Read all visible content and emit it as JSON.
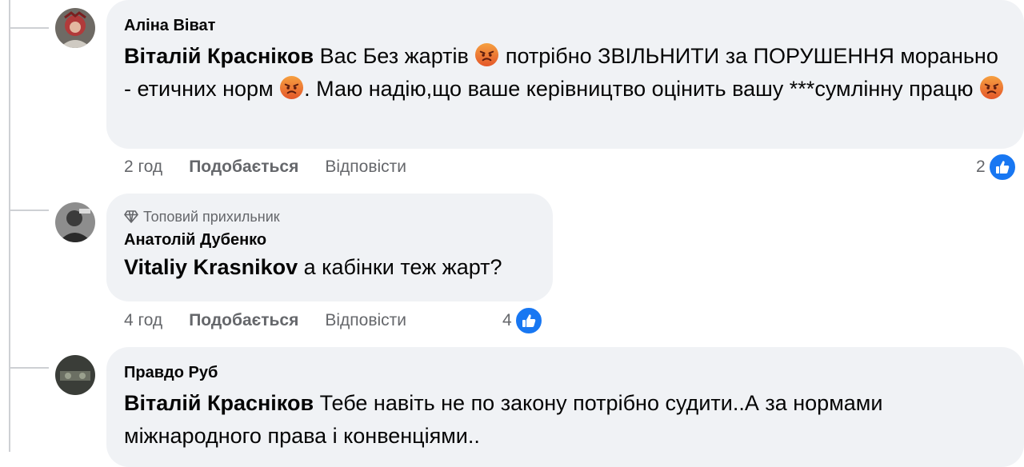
{
  "comments": [
    {
      "author": "Аліна Віват",
      "mention": "Віталій Красніков",
      "text_parts": [
        " Вас Без жартів ",
        " потрібно ЗВІЛЬНИТИ за ПОРУШЕННЯ мораньно - етичних норм ",
        ". Маю надію,що ваше керівництво оцінить вашу ***сумлінну працю "
      ],
      "time": "2 год",
      "like_label": "Подобається",
      "reply_label": "Відповісти",
      "reaction_count": "2"
    },
    {
      "badge": "Топовий прихильник",
      "author": "Анатолій Дубенко",
      "mention": "Vitaliy Krasnikov",
      "text": " а кабінки теж жарт?",
      "time": "4 год",
      "like_label": "Подобається",
      "reply_label": "Відповісти",
      "reaction_count": "4"
    },
    {
      "author": "Правдо Руб",
      "mention": "Віталій Красніков",
      "text": " Тебе навіть не по закону потрібно судити..А за нормами міжнародного права і конвенціями.."
    }
  ],
  "icons": {
    "reaction": "like-icon",
    "emoji": "angry-face-icon",
    "badge": "diamond-icon"
  },
  "colors": {
    "bubble": "#f0f2f5",
    "meta": "#65676b",
    "like": "#1877f2",
    "angry_top": "#f6a040",
    "angry_bottom": "#e4572a"
  }
}
